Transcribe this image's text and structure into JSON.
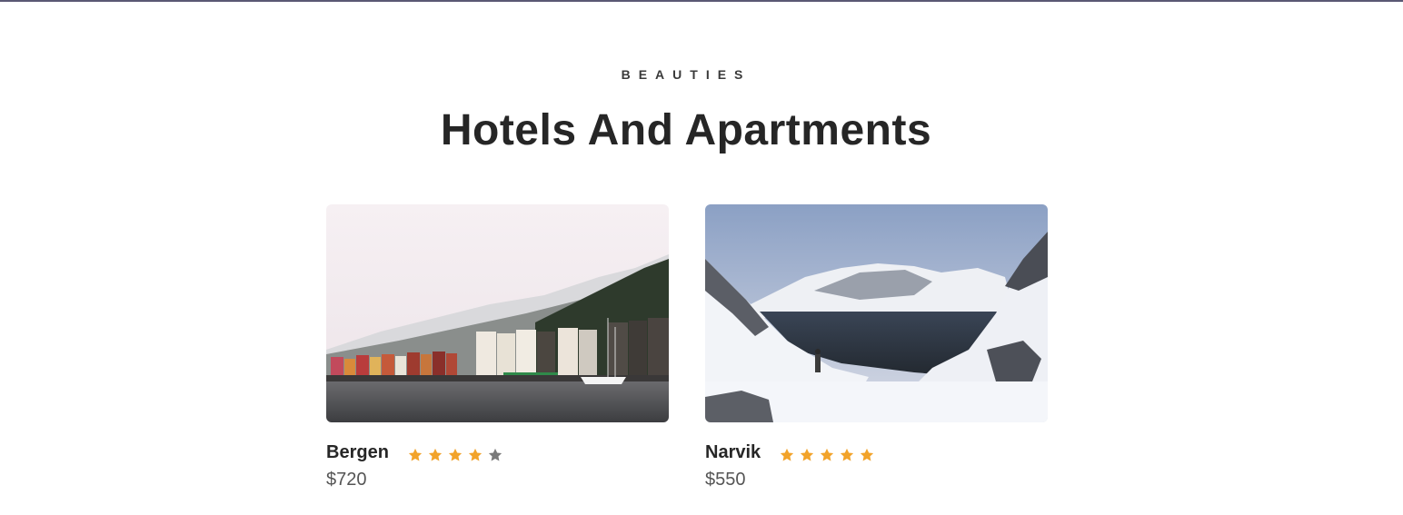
{
  "section": {
    "eyebrow": "BEAUTIES",
    "title": "Hotels And Apartments"
  },
  "colors": {
    "star_filled": "#f2a32a",
    "star_empty": "#7a7a7a",
    "top_rule": "#5a5874"
  },
  "cards": [
    {
      "name": "Bergen",
      "price": "$720",
      "rating": 4,
      "rating_max": 5,
      "image": "harbor-town-photo"
    },
    {
      "name": "Narvik",
      "price": "$550",
      "rating": 5,
      "rating_max": 5,
      "image": "snowy-fjord-photo"
    }
  ]
}
